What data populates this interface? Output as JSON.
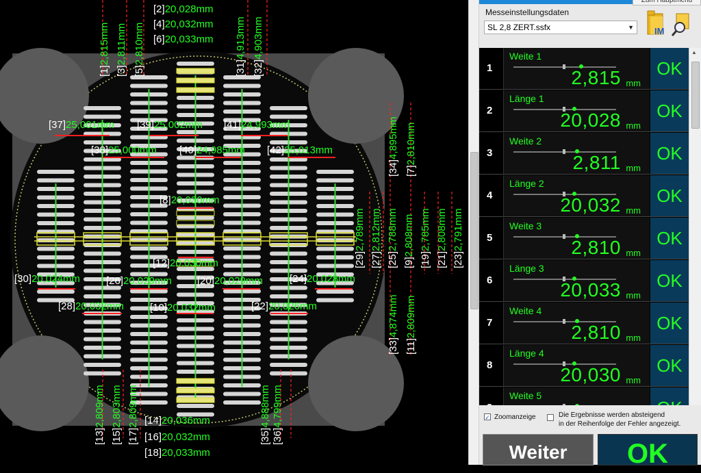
{
  "header": {
    "top_tab_label": "Zum Hauptmenü"
  },
  "settings": {
    "label": "Messeinstellungsdaten",
    "file_value": "SL 2,8 ZERT.ssfx",
    "im_icon_text": "IM"
  },
  "results": [
    {
      "num": "1",
      "name": "Weite 1",
      "value": "2,815",
      "unit": "mm",
      "status": "OK"
    },
    {
      "num": "2",
      "name": "Länge 1",
      "value": "20,028",
      "unit": "mm",
      "status": "OK"
    },
    {
      "num": "3",
      "name": "Weite 2",
      "value": "2,811",
      "unit": "mm",
      "status": "OK"
    },
    {
      "num": "4",
      "name": "Länge 2",
      "value": "20,032",
      "unit": "mm",
      "status": "OK"
    },
    {
      "num": "5",
      "name": "Weite 3",
      "value": "2,810",
      "unit": "mm",
      "status": "OK"
    },
    {
      "num": "6",
      "name": "Länge 3",
      "value": "20,033",
      "unit": "mm",
      "status": "OK"
    },
    {
      "num": "7",
      "name": "Weite 4",
      "value": "2,810",
      "unit": "mm",
      "status": "OK"
    },
    {
      "num": "8",
      "name": "Länge 4",
      "value": "20,030",
      "unit": "mm",
      "status": "OK"
    },
    {
      "num": "9",
      "name": "Weite 5",
      "value": "",
      "unit": "",
      "status": "OK"
    }
  ],
  "options": {
    "zoom_label": "Zoomanzeige",
    "zoom_checked": true,
    "sort_label_1": "Die Ergebnisse werden absteigend",
    "sort_label_2": "in der Reihenfolge der Fehler angezeigt.",
    "sort_checked": false
  },
  "buttons": {
    "next_label": "Weiter",
    "final_status": "OK"
  },
  "measurement_labels": [
    {
      "idx": "[2]",
      "val": "20,028mm"
    },
    {
      "idx": "[4]",
      "val": "20,032mm"
    },
    {
      "idx": "[6]",
      "val": "20,033mm"
    },
    {
      "idx": "[37]",
      "val": "25,001mm"
    },
    {
      "idx": "[39]",
      "val": "25,002mm"
    },
    {
      "idx": "[41]",
      "val": "24,993mm"
    },
    {
      "idx": "[38]",
      "val": "25,000mm"
    },
    {
      "idx": "[40]",
      "val": "24,985mm"
    },
    {
      "idx": "[42]",
      "val": "25,013mm"
    },
    {
      "idx": "[8]",
      "val": "20,030mm"
    },
    {
      "idx": "[12]",
      "val": "20,030mm"
    },
    {
      "idx": "[30]",
      "val": "20,024mm"
    },
    {
      "idx": "[26]",
      "val": "20,029mm"
    },
    {
      "idx": "[20]",
      "val": "20,029mm"
    },
    {
      "idx": "[24]",
      "val": "20,028mm"
    },
    {
      "idx": "[28]",
      "val": "20,032mm"
    },
    {
      "idx": "[10]",
      "val": "20,032mm"
    },
    {
      "idx": "[22]",
      "val": "20,026mm"
    },
    {
      "idx": "[14]",
      "val": "20,036mm"
    },
    {
      "idx": "[16]",
      "val": "20,032mm"
    },
    {
      "idx": "[18]",
      "val": "20,033mm"
    },
    {
      "idx": "[1]",
      "val": "2,815mm"
    },
    {
      "idx": "[3]",
      "val": "2,811mm"
    },
    {
      "idx": "[5]",
      "val": "2,810mm"
    },
    {
      "idx": "[31]",
      "val": "4,913mm"
    },
    {
      "idx": "[32]",
      "val": "4,903mm"
    },
    {
      "idx": "[34]",
      "val": "4,895mm"
    },
    {
      "idx": "[7]",
      "val": "2,810mm"
    },
    {
      "idx": "[29]",
      "val": "2,789mm"
    },
    {
      "idx": "[27]",
      "val": "2,812mm"
    },
    {
      "idx": "[25]",
      "val": "2,788mm"
    },
    {
      "idx": "[9]",
      "val": "2,808mm"
    },
    {
      "idx": "[19]",
      "val": "2,785mm"
    },
    {
      "idx": "[21]",
      "val": "2,808mm"
    },
    {
      "idx": "[23]",
      "val": "2,791mm"
    },
    {
      "idx": "[33]",
      "val": "4,874mm"
    },
    {
      "idx": "[11]",
      "val": "2,809mm"
    },
    {
      "idx": "[13]",
      "val": "2,809mm"
    },
    {
      "idx": "[15]",
      "val": "2,803mm"
    },
    {
      "idx": "[17]",
      "val": "2,809mm"
    },
    {
      "idx": "[35]",
      "val": "4,888mm"
    },
    {
      "idx": "[36]",
      "val": "4,799mm"
    }
  ]
}
